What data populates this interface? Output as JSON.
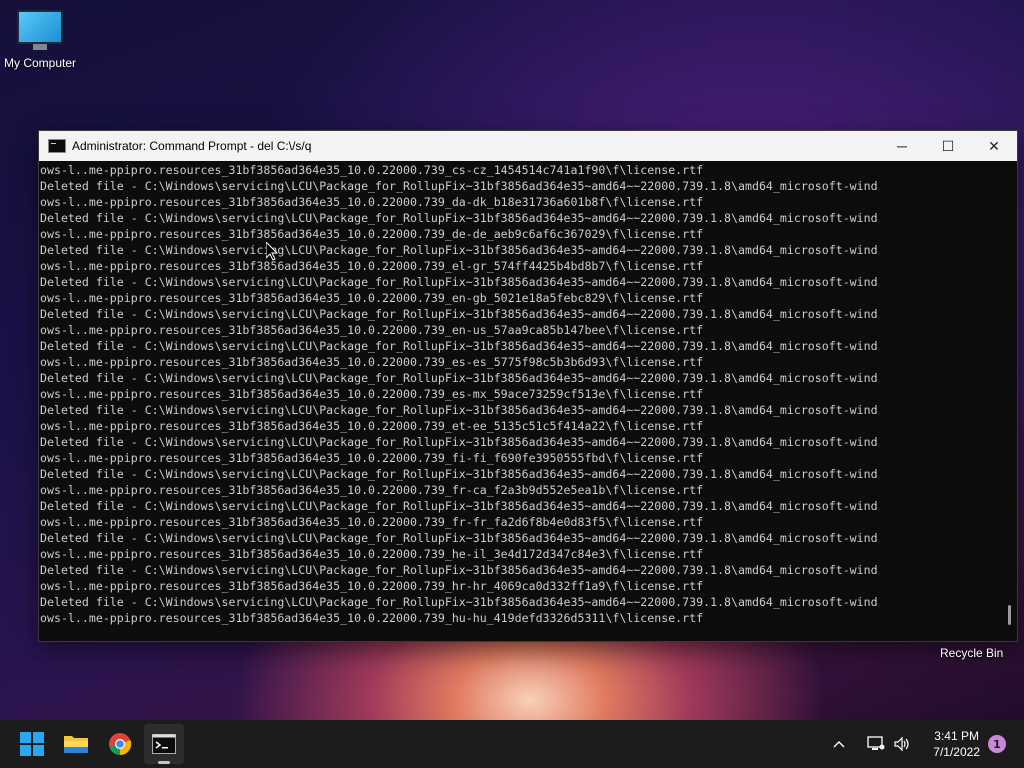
{
  "desktop": {
    "my_computer_label": "My Computer",
    "recycle_bin_label": "Recycle Bin"
  },
  "window": {
    "title": "Administrator: Command Prompt - del  C:\\/s/q",
    "controls": {
      "minimize": "─",
      "maximize": "☐",
      "close": "✕"
    }
  },
  "console": {
    "lines": [
      "ows-l..me-ppipro.resources_31bf3856ad364e35_10.0.22000.739_cs-cz_1454514c741a1f90\\f\\license.rtf",
      "Deleted file - C:\\Windows\\servicing\\LCU\\Package_for_RollupFix~31bf3856ad364e35~amd64~~22000.739.1.8\\amd64_microsoft-wind",
      "ows-l..me-ppipro.resources_31bf3856ad364e35_10.0.22000.739_da-dk_b18e31736a601b8f\\f\\license.rtf",
      "Deleted file - C:\\Windows\\servicing\\LCU\\Package_for_RollupFix~31bf3856ad364e35~amd64~~22000.739.1.8\\amd64_microsoft-wind",
      "ows-l..me-ppipro.resources_31bf3856ad364e35_10.0.22000.739_de-de_aeb9c6af6c367029\\f\\license.rtf",
      "Deleted file - C:\\Windows\\servicing\\LCU\\Package_for_RollupFix~31bf3856ad364e35~amd64~~22000.739.1.8\\amd64_microsoft-wind",
      "ows-l..me-ppipro.resources_31bf3856ad364e35_10.0.22000.739_el-gr_574ff4425b4bd8b7\\f\\license.rtf",
      "Deleted file - C:\\Windows\\servicing\\LCU\\Package_for_RollupFix~31bf3856ad364e35~amd64~~22000.739.1.8\\amd64_microsoft-wind",
      "ows-l..me-ppipro.resources_31bf3856ad364e35_10.0.22000.739_en-gb_5021e18a5febc829\\f\\license.rtf",
      "Deleted file - C:\\Windows\\servicing\\LCU\\Package_for_RollupFix~31bf3856ad364e35~amd64~~22000.739.1.8\\amd64_microsoft-wind",
      "ows-l..me-ppipro.resources_31bf3856ad364e35_10.0.22000.739_en-us_57aa9ca85b147bee\\f\\license.rtf",
      "Deleted file - C:\\Windows\\servicing\\LCU\\Package_for_RollupFix~31bf3856ad364e35~amd64~~22000.739.1.8\\amd64_microsoft-wind",
      "ows-l..me-ppipro.resources_31bf3856ad364e35_10.0.22000.739_es-es_5775f98c5b3b6d93\\f\\license.rtf",
      "Deleted file - C:\\Windows\\servicing\\LCU\\Package_for_RollupFix~31bf3856ad364e35~amd64~~22000.739.1.8\\amd64_microsoft-wind",
      "ows-l..me-ppipro.resources_31bf3856ad364e35_10.0.22000.739_es-mx_59ace73259cf513e\\f\\license.rtf",
      "Deleted file - C:\\Windows\\servicing\\LCU\\Package_for_RollupFix~31bf3856ad364e35~amd64~~22000.739.1.8\\amd64_microsoft-wind",
      "ows-l..me-ppipro.resources_31bf3856ad364e35_10.0.22000.739_et-ee_5135c51c5f414a22\\f\\license.rtf",
      "Deleted file - C:\\Windows\\servicing\\LCU\\Package_for_RollupFix~31bf3856ad364e35~amd64~~22000.739.1.8\\amd64_microsoft-wind",
      "ows-l..me-ppipro.resources_31bf3856ad364e35_10.0.22000.739_fi-fi_f690fe3950555fbd\\f\\license.rtf",
      "Deleted file - C:\\Windows\\servicing\\LCU\\Package_for_RollupFix~31bf3856ad364e35~amd64~~22000.739.1.8\\amd64_microsoft-wind",
      "ows-l..me-ppipro.resources_31bf3856ad364e35_10.0.22000.739_fr-ca_f2a3b9d552e5ea1b\\f\\license.rtf",
      "Deleted file - C:\\Windows\\servicing\\LCU\\Package_for_RollupFix~31bf3856ad364e35~amd64~~22000.739.1.8\\amd64_microsoft-wind",
      "ows-l..me-ppipro.resources_31bf3856ad364e35_10.0.22000.739_fr-fr_fa2d6f8b4e0d83f5\\f\\license.rtf",
      "Deleted file - C:\\Windows\\servicing\\LCU\\Package_for_RollupFix~31bf3856ad364e35~amd64~~22000.739.1.8\\amd64_microsoft-wind",
      "ows-l..me-ppipro.resources_31bf3856ad364e35_10.0.22000.739_he-il_3e4d172d347c84e3\\f\\license.rtf",
      "Deleted file - C:\\Windows\\servicing\\LCU\\Package_for_RollupFix~31bf3856ad364e35~amd64~~22000.739.1.8\\amd64_microsoft-wind",
      "ows-l..me-ppipro.resources_31bf3856ad364e35_10.0.22000.739_hr-hr_4069ca0d332ff1a9\\f\\license.rtf",
      "Deleted file - C:\\Windows\\servicing\\LCU\\Package_for_RollupFix~31bf3856ad364e35~amd64~~22000.739.1.8\\amd64_microsoft-wind",
      "ows-l..me-ppipro.resources_31bf3856ad364e35_10.0.22000.739_hu-hu_419defd3326d5311\\f\\license.rtf"
    ]
  },
  "taskbar": {
    "apps": [
      {
        "name": "start-button",
        "icon": "windows-logo-icon"
      },
      {
        "name": "file-explorer-button",
        "icon": "folder-icon"
      },
      {
        "name": "chrome-button",
        "icon": "chrome-icon"
      },
      {
        "name": "command-prompt-button",
        "icon": "terminal-icon",
        "active": true
      }
    ],
    "clock": {
      "time": "3:41 PM",
      "date": "7/1/2022"
    },
    "notification_count": "1"
  },
  "colors": {
    "console_text": "#cccccc",
    "console_bg": "#0c0c0c",
    "taskbar_bg": "#1c1c1c",
    "notification_badge": "#c88ad8"
  }
}
